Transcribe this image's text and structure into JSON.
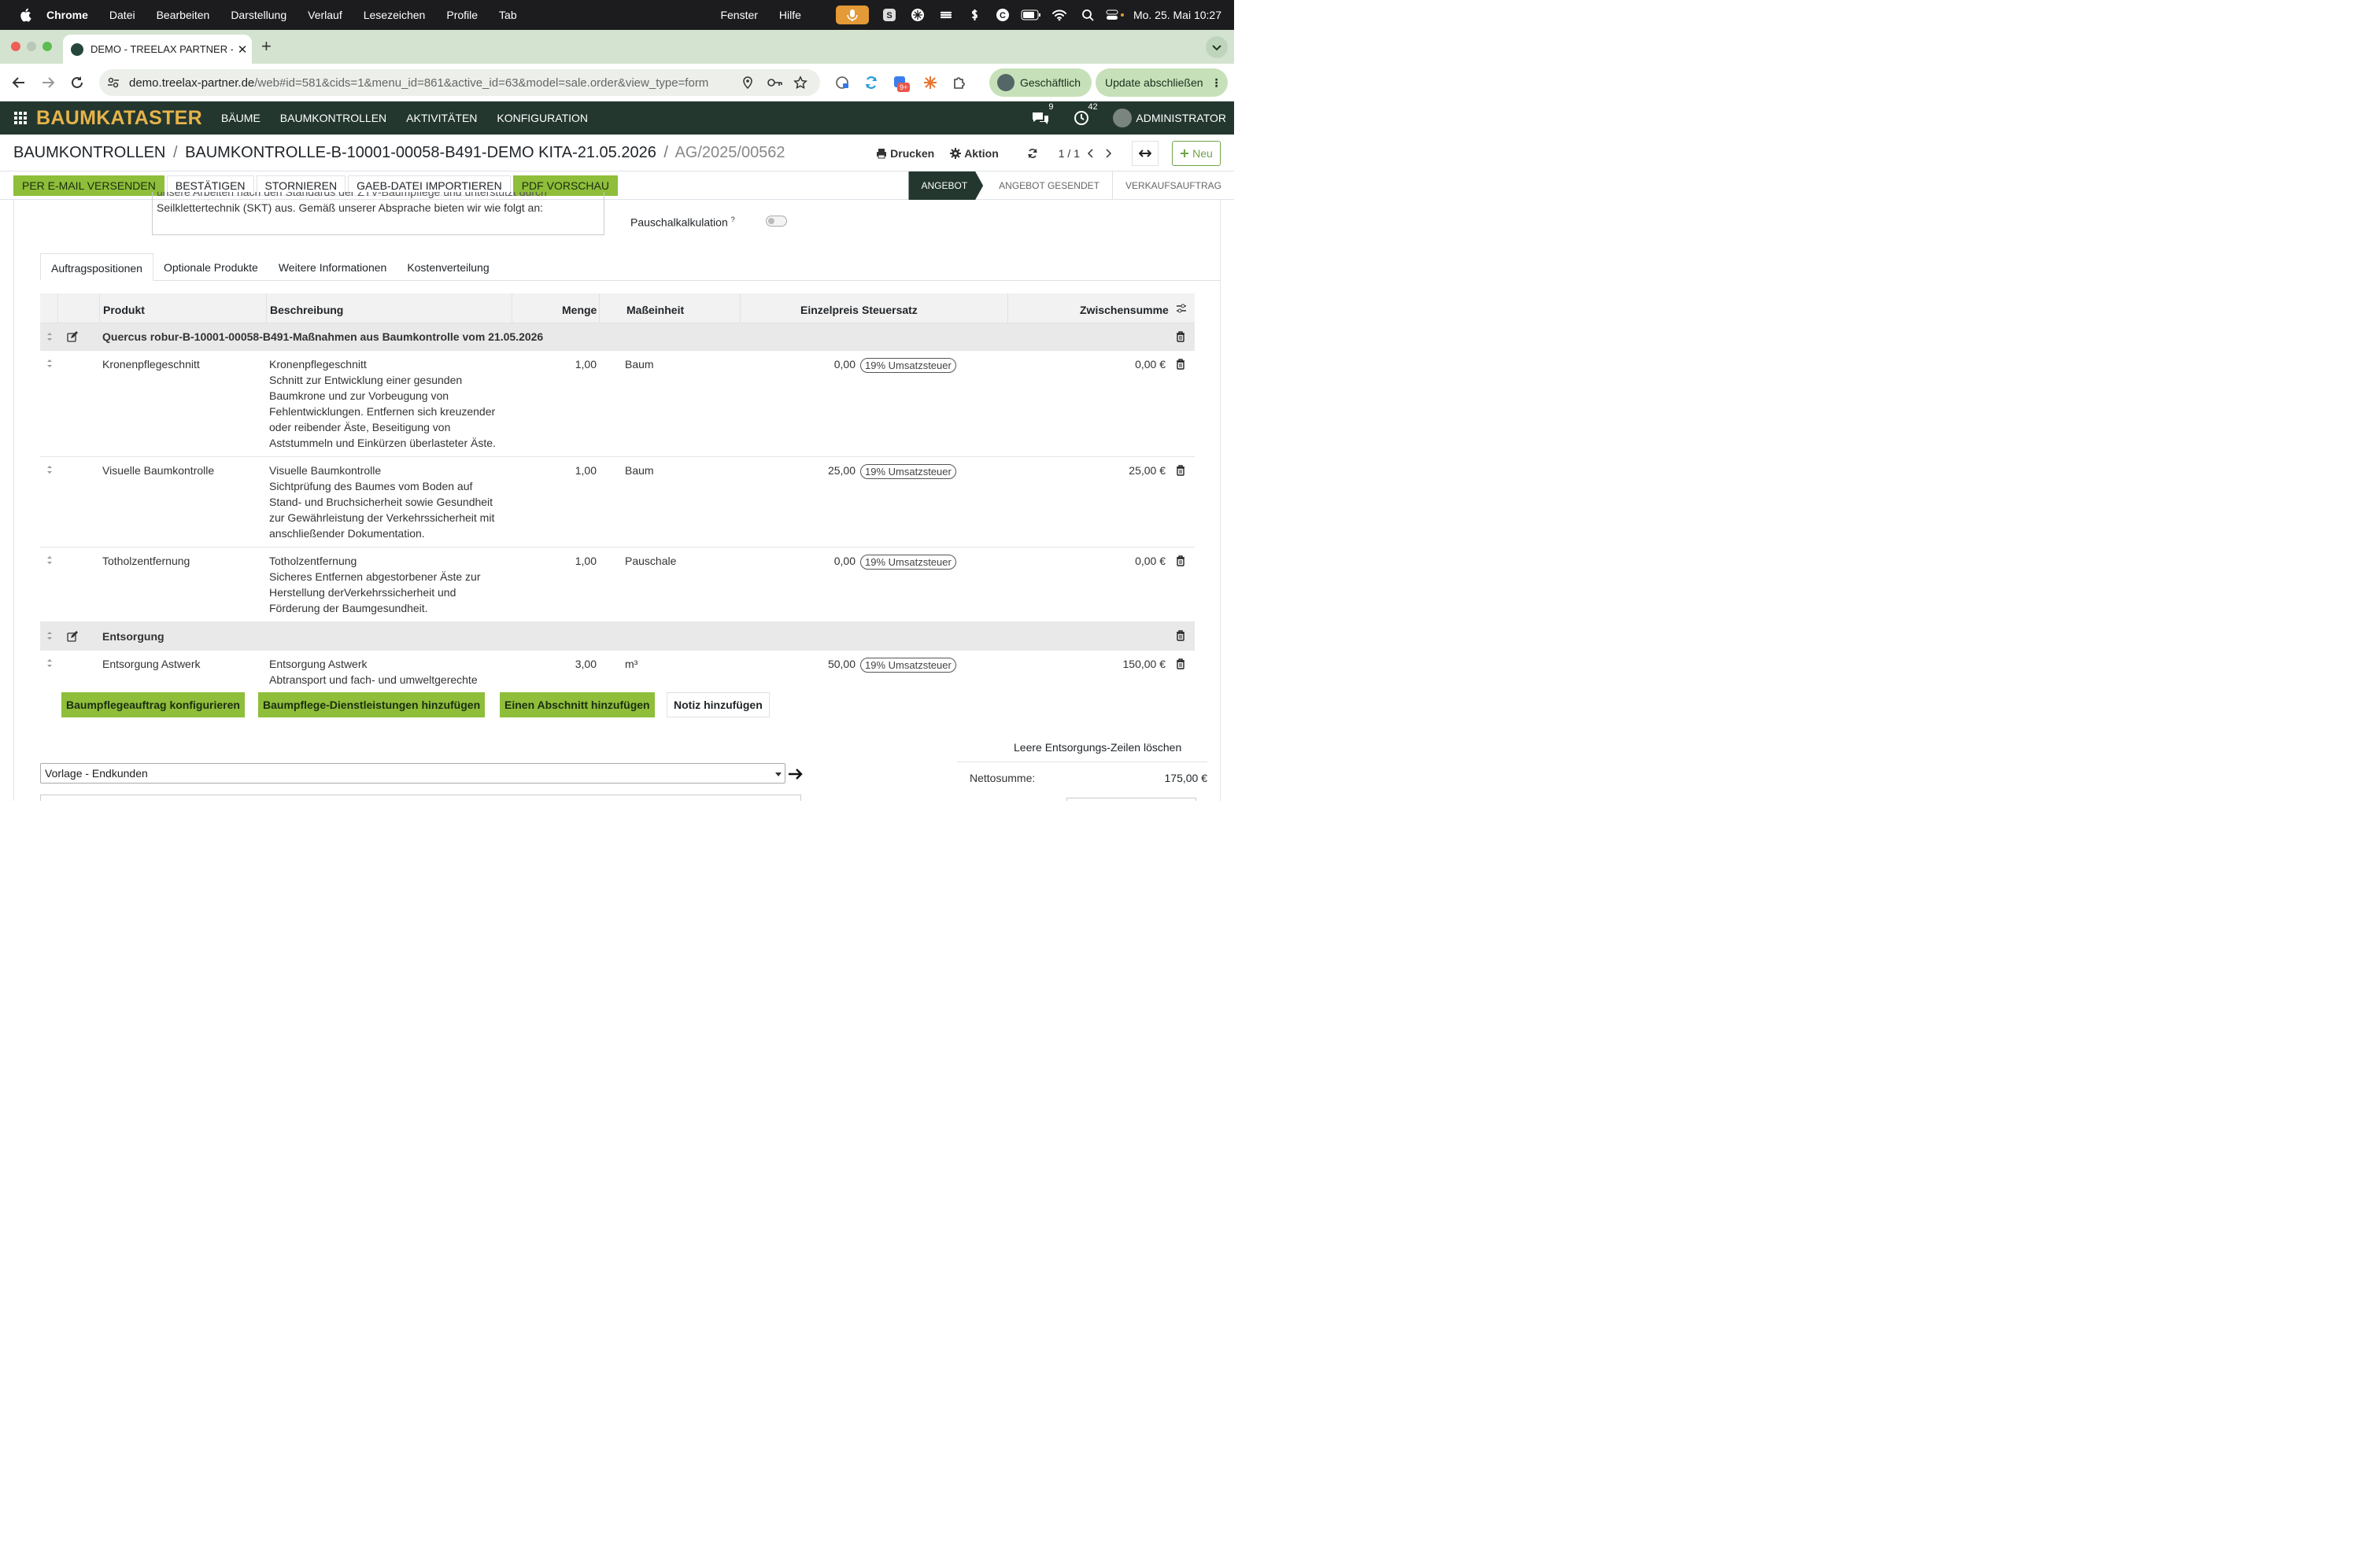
{
  "macos": {
    "app": "Chrome",
    "menu": [
      "Datei",
      "Bearbeiten",
      "Darstellung",
      "Verlauf",
      "Lesezeichen",
      "Profile",
      "Tab"
    ],
    "menu_right": [
      "Fenster",
      "Hilfe"
    ],
    "clock": "Mo. 25. Mai  10:27"
  },
  "chrome": {
    "tab_title": "DEMO - TREELAX PARTNER -",
    "url_host": "demo.treelax-partner.de",
    "url_path": "/web#id=581&cids=1&menu_id=861&active_id=63&model=sale.order&view_type=form",
    "profile_label": "Geschäftlich",
    "update_label": "Update abschließen",
    "ext_badge": "9+"
  },
  "odoo_nav": {
    "brand": "BAUMKATASTER",
    "items": [
      "BÄUME",
      "BAUMKONTROLLEN",
      "AKTIVITÄTEN",
      "KONFIGURATION"
    ],
    "messages_count": "9",
    "activities_count": "42",
    "user": "ADMINISTRATOR"
  },
  "breadcrumb": {
    "root": "BAUMKONTROLLEN",
    "parent": "BAUMKONTROLLE-B-10001-00058-B491-DEMO KITA-21.05.2026",
    "current": "AG/2025/00562",
    "sep": "/",
    "print": "Drucken",
    "action": "Aktion",
    "pager": "1 / 1",
    "new": "Neu"
  },
  "actions": {
    "buttons": [
      "PER E-MAIL VERSENDEN",
      "BESTÄTIGEN",
      "STORNIEREN",
      "GAEB-DATEI IMPORTIEREN",
      "PDF VORSCHAU"
    ],
    "stages": [
      "ANGEBOT",
      "ANGEBOT GESENDET",
      "VERKAUFSAUFTRAG"
    ]
  },
  "form": {
    "desc_hidden": "unsere Arbeiten nach den Standards der ZTV-Baumpflege und unterstützt durch",
    "desc_line": "Seilklettertechnik (SKT) aus. Gemäß unserer Absprache bieten wir wie folgt an:",
    "flat_calc_label": "Pauschalkalkulation",
    "flat_calc_help": "?",
    "tabs": [
      "Auftragspositionen",
      "Optionale Produkte",
      "Weitere Informationen",
      "Kostenverteilung"
    ]
  },
  "table": {
    "headers": {
      "product": "Produkt",
      "description": "Beschreibung",
      "qty": "Menge",
      "uom": "Maßeinheit",
      "price": "Einzelpreis",
      "tax": "Steuersatz",
      "subtotal": "Zwischensumme"
    },
    "section1": "Quercus robur-B-10001-00058-B491-Maßnahmen aus Baumkontrolle vom 21.05.2026",
    "lines": [
      {
        "product": "Kronenpflegeschnitt",
        "desc": [
          "Kronenpflegeschnitt",
          "Schnitt zur Entwicklung einer gesunden",
          "Baumkrone und zur Vorbeugung von",
          "Fehlentwicklungen. Entfernen sich kreuzender",
          "oder reibender Äste, Beseitigung von",
          "Aststummeln und Einkürzen überlasteter Äste."
        ],
        "qty": "1,00",
        "uom": "Baum",
        "price": "0,00",
        "tax": "19% Umsatzsteuer",
        "subtotal": "0,00 €"
      },
      {
        "product": "Visuelle Baumkontrolle",
        "desc": [
          "Visuelle Baumkontrolle",
          "Sichtprüfung des Baumes vom Boden auf",
          "Stand- und Bruchsicherheit sowie Gesundheit",
          "zur Gewährleistung der Verkehrssicherheit mit",
          "anschließender Dokumentation."
        ],
        "qty": "1,00",
        "uom": "Baum",
        "price": "25,00",
        "tax": "19% Umsatzsteuer",
        "subtotal": "25,00 €"
      },
      {
        "product": "Totholzentfernung",
        "desc": [
          "Totholzentfernung",
          "Sicheres Entfernen abgestorbener Äste zur",
          "Herstellung derVerkehrssicherheit und",
          "Förderung der Baumgesundheit."
        ],
        "qty": "1,00",
        "uom": "Pauschale",
        "price": "0,00",
        "tax": "19% Umsatzsteuer",
        "subtotal": "0,00 €"
      }
    ],
    "section2": "Entsorgung",
    "line4": {
      "product": "Entsorgung Astwerk",
      "desc": [
        "Entsorgung Astwerk",
        "Abtransport und fach- und umweltgerechte"
      ],
      "qty": "3,00",
      "uom": "m³",
      "price": "50,00",
      "tax": "19% Umsatzsteuer",
      "subtotal": "150,00 €"
    }
  },
  "bottom": {
    "btn_configure": "Baumpflegeauftrag konfigurieren",
    "btn_services": "Baumpflege-Dienstleistungen hinzufügen",
    "btn_section": "Einen Abschnitt hinzufügen",
    "btn_note": "Notiz hinzufügen",
    "clear_disposal": "Leere Entsorgungs-Zeilen löschen",
    "template_value": "Vorlage - Endkunden",
    "net_label": "Nettosumme:",
    "net_value": "175,00 €"
  },
  "colors": {
    "nav": "#23372f",
    "brand": "#e6b34a",
    "accent_green": "#8fbe3a",
    "tabstrip": "#d3e3d0"
  }
}
